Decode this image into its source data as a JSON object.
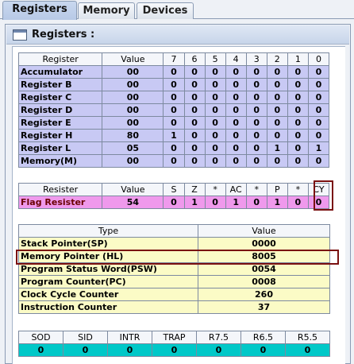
{
  "tabs": [
    "Registers",
    "Memory",
    "Devices"
  ],
  "panel_title": "Registers :",
  "register_table": {
    "headers": [
      "Register",
      "Value",
      "7",
      "6",
      "5",
      "4",
      "3",
      "2",
      "1",
      "0"
    ],
    "rows": [
      [
        "Accumulator",
        "00",
        "0",
        "0",
        "0",
        "0",
        "0",
        "0",
        "0",
        "0"
      ],
      [
        "Register B",
        "00",
        "0",
        "0",
        "0",
        "0",
        "0",
        "0",
        "0",
        "0"
      ],
      [
        "Register C",
        "00",
        "0",
        "0",
        "0",
        "0",
        "0",
        "0",
        "0",
        "0"
      ],
      [
        "Register D",
        "00",
        "0",
        "0",
        "0",
        "0",
        "0",
        "0",
        "0",
        "0"
      ],
      [
        "Register E",
        "00",
        "0",
        "0",
        "0",
        "0",
        "0",
        "0",
        "0",
        "0"
      ],
      [
        "Register H",
        "80",
        "1",
        "0",
        "0",
        "0",
        "0",
        "0",
        "0",
        "0"
      ],
      [
        "Register L",
        "05",
        "0",
        "0",
        "0",
        "0",
        "0",
        "1",
        "0",
        "1"
      ],
      [
        "Memory(M)",
        "00",
        "0",
        "0",
        "0",
        "0",
        "0",
        "0",
        "0",
        "0"
      ]
    ]
  },
  "flag_table": {
    "headers": [
      "Resister",
      "Value",
      "S",
      "Z",
      "*",
      "AC",
      "*",
      "P",
      "*",
      "CY"
    ],
    "row": [
      "Flag Resister",
      "54",
      "0",
      "1",
      "0",
      "1",
      "0",
      "1",
      "0",
      "0"
    ]
  },
  "pointer_table": {
    "headers": [
      "Type",
      "Value"
    ],
    "rows": [
      [
        "Stack Pointer(SP)",
        "0000"
      ],
      [
        "Memory Pointer (HL)",
        "8005"
      ],
      [
        "Program Status Word(PSW)",
        "0054"
      ],
      [
        "Program Counter(PC)",
        "0008"
      ],
      [
        "Clock Cycle Counter",
        "260"
      ],
      [
        "Instruction Counter",
        "37"
      ]
    ]
  },
  "interrupt_table": {
    "headers": [
      "SOD",
      "SID",
      "INTR",
      "TRAP",
      "R7.5",
      "R6.5",
      "R5.5"
    ],
    "row": [
      "0",
      "0",
      "0",
      "0",
      "0",
      "0",
      "0"
    ]
  },
  "colors": {
    "register_cell": "#c8c9f4",
    "flag_cell": "#ef99ec",
    "pointer_cell": "#fbfbc6",
    "interrupt_cell": "#00c8c8",
    "highlight_border": "#7a1010"
  }
}
